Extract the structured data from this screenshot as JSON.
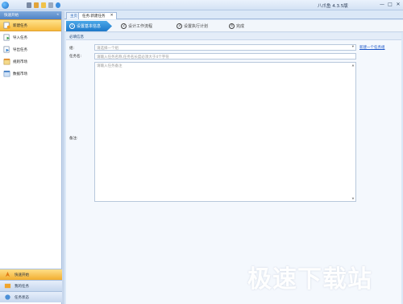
{
  "app": {
    "title": "八爪鱼 4.3.5版"
  },
  "window_buttons": {
    "minimize": "—",
    "restore": "□",
    "close": "✕"
  },
  "sidebar": {
    "header": "快速开始",
    "collapse": "«",
    "items": [
      {
        "label": "新建任务",
        "icon": "new-task-icon",
        "active": true
      },
      {
        "label": "导入任务",
        "icon": "import-icon",
        "active": false
      },
      {
        "label": "导出任务",
        "icon": "export-icon",
        "active": false
      },
      {
        "label": "规则市场",
        "icon": "rules-market-icon",
        "active": false
      },
      {
        "label": "数据市场",
        "icon": "data-market-icon",
        "active": false
      }
    ],
    "sections": [
      {
        "label": "快速开始",
        "icon": "quick-start-icon",
        "active": true
      },
      {
        "label": "我的任务",
        "icon": "my-tasks-icon",
        "active": false
      },
      {
        "label": "任务状态",
        "icon": "task-status-icon",
        "active": false
      }
    ]
  },
  "tabs": {
    "home": "主页",
    "current": "任务:新建任务",
    "close": "✕"
  },
  "steps": [
    {
      "num": "1",
      "label": "设置基本信息",
      "active": true
    },
    {
      "num": "2",
      "label": "设计工作流程",
      "active": false
    },
    {
      "num": "3",
      "label": "设置执行计划",
      "active": false
    },
    {
      "num": "4",
      "label": "完成",
      "active": false
    }
  ],
  "form": {
    "section_title": "必填信息",
    "group_label": "组:",
    "group_placeholder": "请选择一个组",
    "new_group_link": "新建一个任务组",
    "name_label": "任务名:",
    "name_placeholder": "请输入任务名称,任务名长度必须大于4个字符",
    "note_label": "备注:",
    "note_placeholder": "请输入任务备注"
  },
  "watermark": "极速下载站",
  "colors": {
    "accent_blue": "#1e79c9",
    "active_orange": "#f6b93c",
    "link": "#1a55c8"
  }
}
